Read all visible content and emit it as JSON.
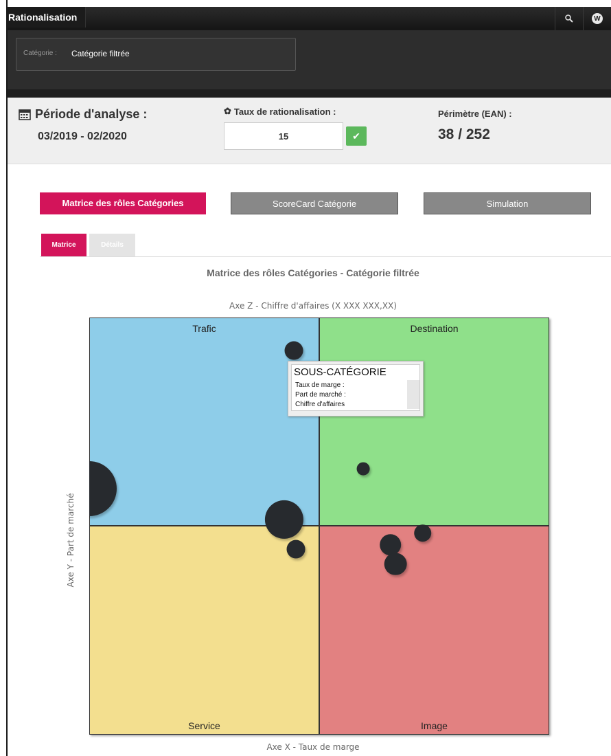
{
  "app": {
    "title": "Rationalisation"
  },
  "header": {
    "search_icon": "search-icon",
    "user_initial": "W"
  },
  "filter": {
    "label": "Catégorie :",
    "value": "Catégorie filtrée"
  },
  "info": {
    "period_label": "Période d'analyse :",
    "period_value": "03/2019 - 02/2020",
    "taux_label": "Taux de rationalisation :",
    "taux_value": "15",
    "perimetre_label": "Périmètre (EAN) :",
    "perimetre_value": "38 / 252"
  },
  "nav": {
    "matrice": "Matrice des rôles Catégories",
    "scorecard": "ScoreCard Catégorie",
    "simulation": "Simulation"
  },
  "tabs": {
    "matrice": "Matrice",
    "details": "Détails"
  },
  "colors": {
    "accent": "#d3145a",
    "trafic": "#8ecde9",
    "destination": "#8fe08a",
    "service": "#f3df8f",
    "image": "#e28181",
    "bubble": "#272a2e"
  },
  "chart_data": {
    "type": "scatter",
    "title": "Matrice des rôles Catégories - Catégorie filtrée",
    "zlabel": "Axe Z - Chiffre d'affaires (X XXX XXX,XX)",
    "xlabel": "Axe X - Taux de marge",
    "ylabel": "Axe Y - Part de marché",
    "xlim": [
      0,
      100
    ],
    "ylim": [
      0,
      100
    ],
    "quadrants": {
      "top_left": "Trafic",
      "top_right": "Destination",
      "bottom_left": "Service",
      "bottom_right": "Image"
    },
    "points": [
      {
        "x": 0,
        "y": 59,
        "z": 100
      },
      {
        "x": 42.4,
        "y": 51.6,
        "z": 46
      },
      {
        "x": 44.5,
        "y": 92.1,
        "z": 8
      },
      {
        "x": 44.9,
        "y": 44.5,
        "z": 8
      },
      {
        "x": 59.6,
        "y": 63.8,
        "z": 3
      },
      {
        "x": 65.5,
        "y": 45.5,
        "z": 12
      },
      {
        "x": 66.6,
        "y": 40.9,
        "z": 13
      },
      {
        "x": 72.5,
        "y": 48.3,
        "z": 7
      }
    ],
    "tooltip": {
      "title": "SOUS-CATÉGORIE",
      "rows": [
        "Taux de marge :",
        "Part de marché :",
        "Chiffre d'affaires"
      ]
    }
  }
}
